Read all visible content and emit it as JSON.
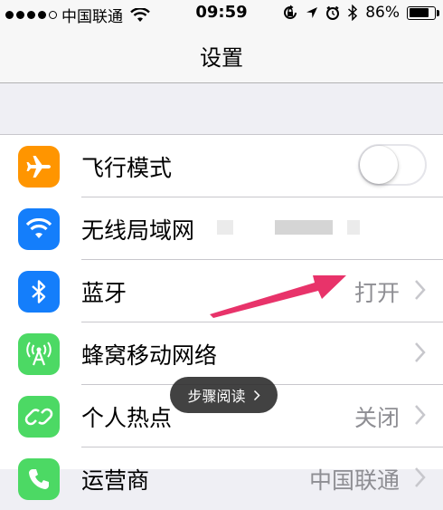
{
  "status_bar": {
    "signal_dots": 4,
    "carrier": "中国联通",
    "time": "09:59",
    "battery_percent": "86%",
    "battery_level": 0.86,
    "icons": [
      "wifi-icon",
      "rotation-lock-icon",
      "location-icon",
      "alarm-icon",
      "bluetooth-icon",
      "battery-icon"
    ]
  },
  "nav": {
    "title": "设置"
  },
  "settings": {
    "airplane": {
      "label": "飞行模式",
      "toggle_on": false,
      "icon": "airplane-icon",
      "color": "#ff9500"
    },
    "wifi": {
      "label": "无线局域网",
      "icon": "wifi-icon",
      "color": "#147efb"
    },
    "bluetooth": {
      "label": "蓝牙",
      "value": "打开",
      "icon": "bluetooth-icon",
      "color": "#147efb"
    },
    "cellular": {
      "label": "蜂窝移动网络",
      "icon": "cellular-antenna-icon",
      "color": "#4cd964"
    },
    "hotspot": {
      "label": "个人热点",
      "value": "关闭",
      "icon": "hotspot-icon",
      "color": "#4cd964"
    },
    "carrier": {
      "label": "运营商",
      "value": "中国联通",
      "icon": "phone-icon",
      "color": "#4cd964"
    }
  },
  "overlay": {
    "guide_label": "步骤阅读",
    "arrow_color": "#e8336a"
  }
}
